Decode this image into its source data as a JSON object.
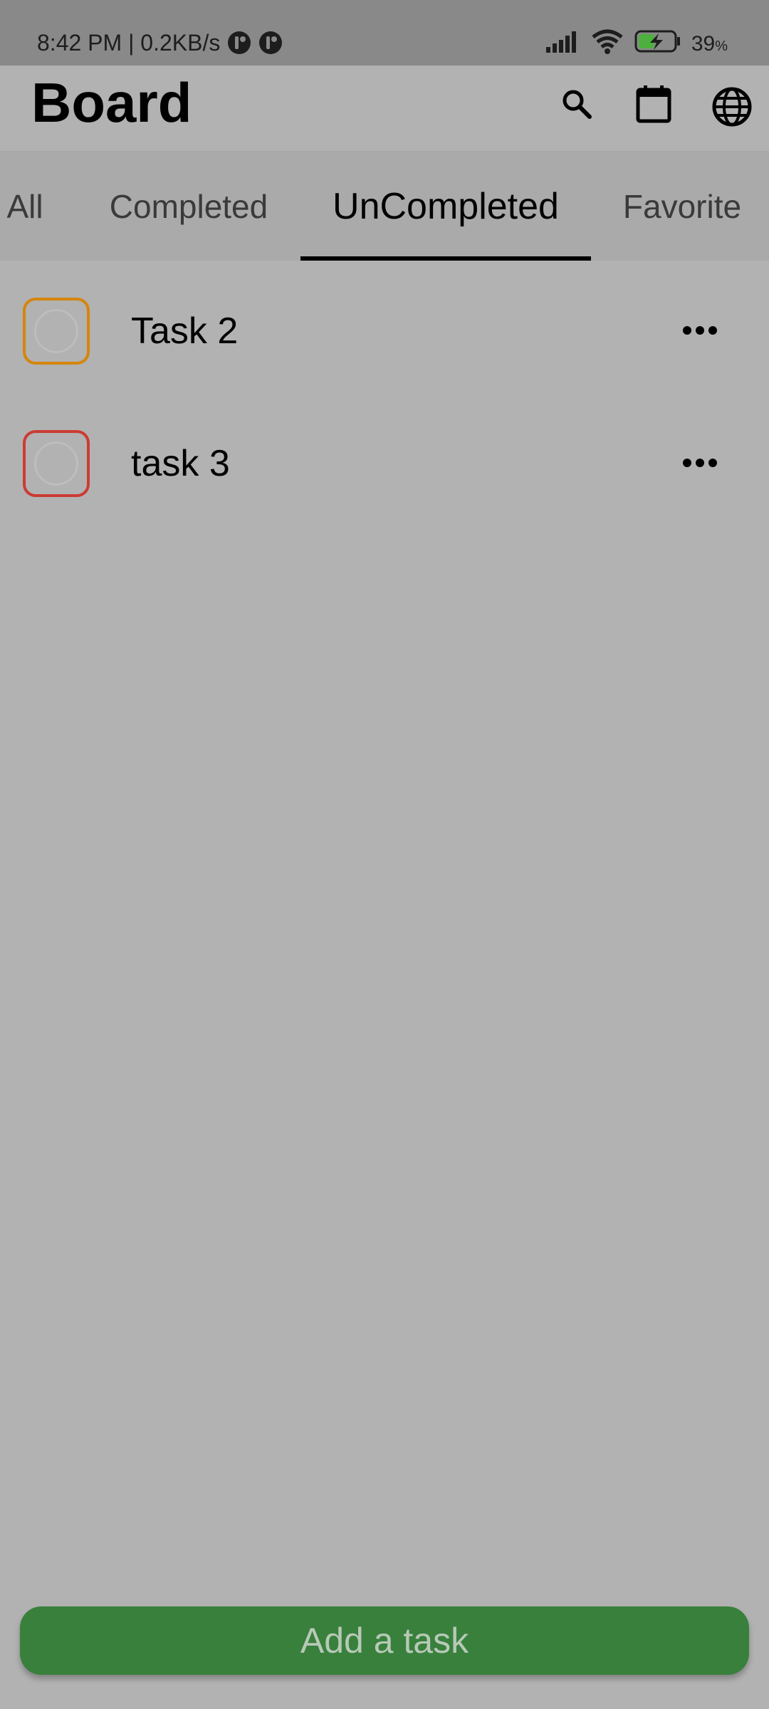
{
  "status_bar": {
    "time_speed": "8:42 PM | 0.2KB/s",
    "battery_percent": "39",
    "battery_suffix": "%"
  },
  "header": {
    "title": "Board",
    "icons": [
      "search-icon",
      "calendar-icon",
      "globe-icon"
    ]
  },
  "tabs": [
    {
      "label": "All",
      "active": false
    },
    {
      "label": "Completed",
      "active": false
    },
    {
      "label": "UnCompleted",
      "active": true
    },
    {
      "label": "Favorite",
      "active": false
    }
  ],
  "tasks": [
    {
      "title": "Task 2",
      "priority_color": "#d5850e"
    },
    {
      "title": "task 3",
      "priority_color": "#cc3b34"
    }
  ],
  "add_button": {
    "label": "Add a task"
  },
  "colors": {
    "background": "#b2b2b2",
    "accent_green": "#38803c",
    "status_bar": "#898989"
  }
}
